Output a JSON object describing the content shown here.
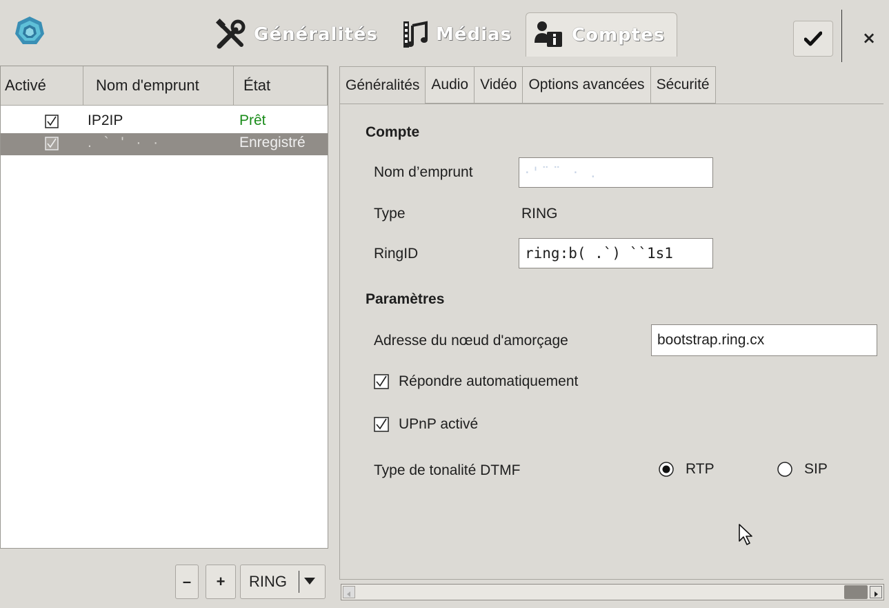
{
  "toolbar": {
    "tabs": [
      {
        "label": "Généralités",
        "icon": "tools-icon"
      },
      {
        "label": "Médias",
        "icon": "film-music-icon"
      },
      {
        "label": "Comptes",
        "icon": "user-info-icon"
      }
    ],
    "active_tab": "Comptes",
    "apply_icon": "checkmark-icon",
    "close_label": "×"
  },
  "account_list": {
    "columns": [
      "Activé",
      "Nom d'emprunt",
      "État"
    ],
    "rows": [
      {
        "enabled": true,
        "alias": "IP2IP",
        "state": "Prêt",
        "state_color": "#1a8c1a"
      },
      {
        "enabled": true,
        "alias": ". ` ' · ·",
        "state": "Enregistré",
        "selected": true
      }
    ],
    "remove_label": "–",
    "add_label": "+",
    "type_selected": "RING"
  },
  "settings": {
    "tabs": [
      "Généralités",
      "Audio",
      "Vidéo",
      "Options avancées",
      "Sécurité"
    ],
    "active_tab": "Généralités",
    "account_section": {
      "title": "Compte",
      "alias_label": "Nom d’emprunt",
      "alias_value": "·'¨¨ ·  .",
      "type_label": "Type",
      "type_value": "RING",
      "ringid_label": "RingID",
      "ringid_value": "ring:b( .`) ``1s1"
    },
    "params_section": {
      "title": "Paramètres",
      "bootstrap_label": "Adresse du nœud d'amorçage",
      "bootstrap_value": "bootstrap.ring.cx",
      "auto_answer_label": "Répondre automatiquement",
      "auto_answer_checked": true,
      "upnp_label": "UPnP activé",
      "upnp_checked": true,
      "dtmf_label": "Type de tonalité DTMF",
      "dtmf_options": [
        "RTP",
        "SIP"
      ],
      "dtmf_selected": "RTP"
    }
  },
  "colors": {
    "window_bg": "#dcdad5",
    "selection_bg": "#918d88",
    "ready_green": "#1a8c1a"
  }
}
